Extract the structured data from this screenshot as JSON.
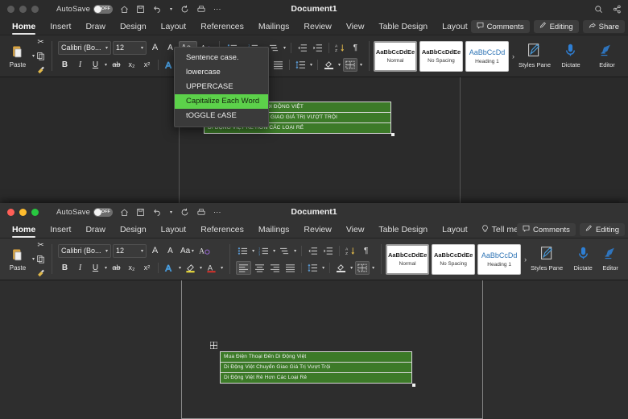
{
  "app": {
    "name": "Microsoft Word",
    "document_title": "Document1",
    "autosave_label": "AutoSave",
    "autosave_state": "OFF",
    "accent_green": "#5cd14a",
    "table_cell_green": "#3c7a28",
    "heading_blue": "#2e74b5"
  },
  "quick_access": {
    "home_icon": "home-icon",
    "save_icon": "save-icon",
    "undo_icon": "undo-icon",
    "redo_icon": "redo-icon",
    "print_icon": "print-icon",
    "more_icon": "ellipsis-icon"
  },
  "titlebar_right": {
    "search_icon": "search-icon",
    "share_icon": "share-icon"
  },
  "ribbon_tabs": [
    {
      "label": "Home",
      "selected": true
    },
    {
      "label": "Insert",
      "selected": false
    },
    {
      "label": "Draw",
      "selected": false
    },
    {
      "label": "Design",
      "selected": false
    },
    {
      "label": "Layout",
      "selected": false
    },
    {
      "label": "References",
      "selected": false
    },
    {
      "label": "Mailings",
      "selected": false
    },
    {
      "label": "Review",
      "selected": false
    },
    {
      "label": "View",
      "selected": false
    },
    {
      "label": "Table Design",
      "selected": false
    },
    {
      "label": "Layout",
      "selected": false
    }
  ],
  "tell_me": {
    "label": "Tell me",
    "icon": "lightbulb-icon"
  },
  "tabs_right": {
    "comments": {
      "label": "Comments",
      "icon": "comment-icon"
    },
    "editing": {
      "label": "Editing",
      "icon": "pencil-icon"
    },
    "share": {
      "label": "Share",
      "icon": "share-icon"
    }
  },
  "ribbon": {
    "clipboard": {
      "paste_label": "Paste",
      "paste_icon": "clipboard-icon",
      "cut_icon": "scissors-icon",
      "copy_icon": "copy-icon",
      "format_painter_icon": "paintbrush-icon"
    },
    "font": {
      "font_name": "Calibri (Bo...",
      "font_size": "12",
      "grow_font": "A",
      "shrink_font": "A",
      "change_case": "Aa",
      "clear_formatting_icon": "clear-formatting-icon",
      "bold": "B",
      "italic": "I",
      "underline": "U",
      "strikethrough": "ab",
      "subscript": "x₂",
      "superscript": "x²",
      "text_effects_icon": "text-effects-icon",
      "highlight_icon": "highlight-icon",
      "font_color_icon": "font-color-icon"
    },
    "paragraph": {
      "bullets_icon": "bullet-list-icon",
      "numbering_icon": "numbered-list-icon",
      "multilevel_icon": "multilevel-list-icon",
      "decrease_indent_icon": "decrease-indent-icon",
      "increase_indent_icon": "increase-indent-icon",
      "sort_icon": "sort-icon",
      "show_marks_icon": "pilcrow-icon",
      "align_left_icon": "align-left-icon",
      "align_center_icon": "align-center-icon",
      "align_right_icon": "align-right-icon",
      "justify_icon": "justify-icon",
      "line_spacing_icon": "line-spacing-icon",
      "shading_icon": "shading-icon",
      "borders_icon": "borders-icon"
    },
    "styles": [
      {
        "sample": "AaBbCcDdEe",
        "name": "Normal",
        "selected": true,
        "heading": false
      },
      {
        "sample": "AaBbCcDdEe",
        "name": "No Spacing",
        "selected": false,
        "heading": false
      },
      {
        "sample": "AaBbCcDd",
        "name": "Heading 1",
        "selected": false,
        "heading": true
      }
    ],
    "styles_more": "›",
    "styles_pane": {
      "label": "Styles Pane",
      "icon": "styles-pane-icon"
    },
    "dictate": {
      "label": "Dictate",
      "icon": "microphone-icon"
    },
    "editor": {
      "label": "Editor",
      "icon": "editor-icon"
    }
  },
  "change_case_menu": {
    "open": true,
    "items": [
      {
        "label": "Sentence case.",
        "highlighted": false
      },
      {
        "label": "lowercase",
        "highlighted": false
      },
      {
        "label": "UPPERCASE",
        "highlighted": false
      },
      {
        "label": "Capitalize Each Word",
        "highlighted": true
      },
      {
        "label": "tOGGLE cASE",
        "highlighted": false
      }
    ]
  },
  "document_top": {
    "table_handle_icon": "table-move-handle-icon",
    "rows": [
      "MUA ĐIỆN THOẠI ĐẾN DI ĐỘNG VIỆT",
      "DI ĐỘNG VIỆT CHUYỂN GIAO GIÁ TRỊ VƯỢT TRỘI",
      "DI ĐỘNG VIỆT RẺ HƠN CÁC LOẠI RẺ"
    ]
  },
  "document_bottom": {
    "table_handle_icon": "table-move-handle-icon",
    "rows": [
      "Mua Điện Thoại Đến Di Động Việt",
      "Di Động Việt Chuyển Giao Giá Trị Vượt Trội",
      "Di Động Việt Rẻ Hơn Các Loại Rẻ"
    ]
  }
}
